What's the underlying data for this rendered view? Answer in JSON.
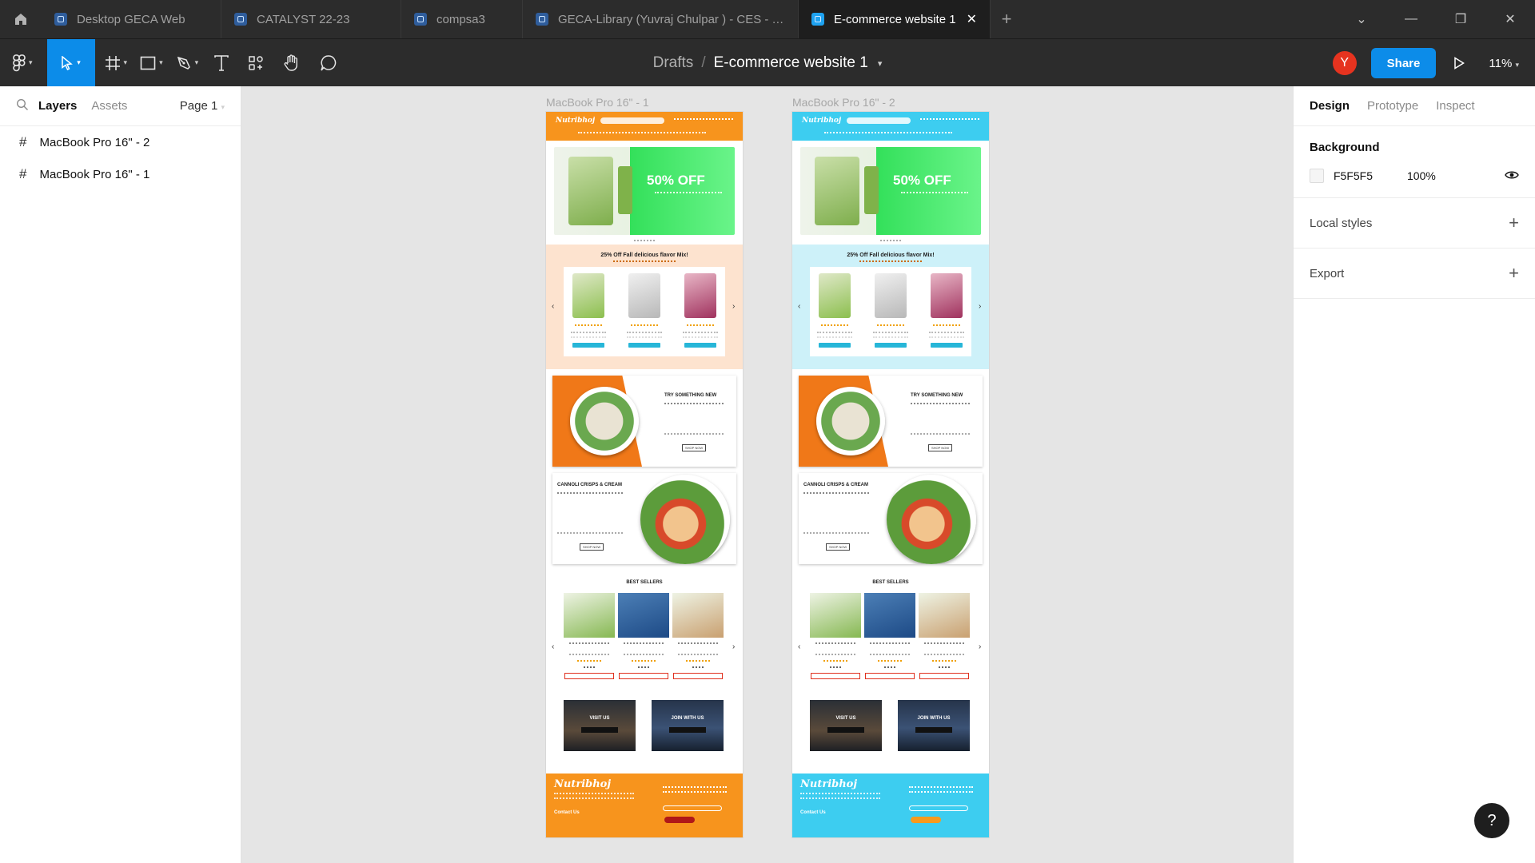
{
  "tabs": [
    {
      "label": "Desktop GECA Web",
      "active": false
    },
    {
      "label": "CATALYST 22-23",
      "active": false
    },
    {
      "label": "compsa3",
      "active": false
    },
    {
      "label": "GECA-Library (Yuvraj Chulpar ) - CES - TY",
      "active": false
    },
    {
      "label": "E-commerce website 1",
      "active": true
    }
  ],
  "toolbar": {
    "breadcrumb_drafts": "Drafts",
    "breadcrumb_sep": "/",
    "file_name": "E-commerce website 1",
    "avatar_initial": "Y",
    "share_label": "Share",
    "zoom": "11%"
  },
  "left_panel": {
    "tab_layers": "Layers",
    "tab_assets": "Assets",
    "page": "Page 1",
    "layers": [
      "MacBook Pro 16\" - 2",
      "MacBook Pro 16\" - 1"
    ]
  },
  "right_panel": {
    "tab_design": "Design",
    "tab_prototype": "Prototype",
    "tab_inspect": "Inspect",
    "background_title": "Background",
    "background_hex": "F5F5F5",
    "background_opacity": "100%",
    "local_styles": "Local styles",
    "export": "Export"
  },
  "help_label": "?",
  "canvas": {
    "frames": [
      {
        "label": "MacBook Pro 16\" - 1",
        "theme": "orange",
        "accent": "#f7941d",
        "light": "#fde3cf"
      },
      {
        "label": "MacBook Pro 16\" - 2",
        "theme": "blue",
        "accent": "#3dcdf0",
        "light": "#cdf1f9"
      }
    ],
    "site": {
      "logo": "Nutribhoj",
      "hero_offer": "50% OFF",
      "flavor_title": "25% Off Fall delicious flavor Mix!",
      "try_title": "TRY SOMETHING NEW",
      "cannoli_title": "CANNOLI CRISPS & CREAM",
      "shop_now": "SHOP NOW",
      "best_sellers": "BEST SELLERS",
      "visit_us": "VISIT US",
      "join_us": "JOIN WITH US",
      "contact_us": "Contact Us"
    }
  },
  "colors": {
    "app_chrome": "#2c2c2c",
    "accent_blue": "#0c8ce9",
    "canvas_bg": "#e5e5e5"
  }
}
